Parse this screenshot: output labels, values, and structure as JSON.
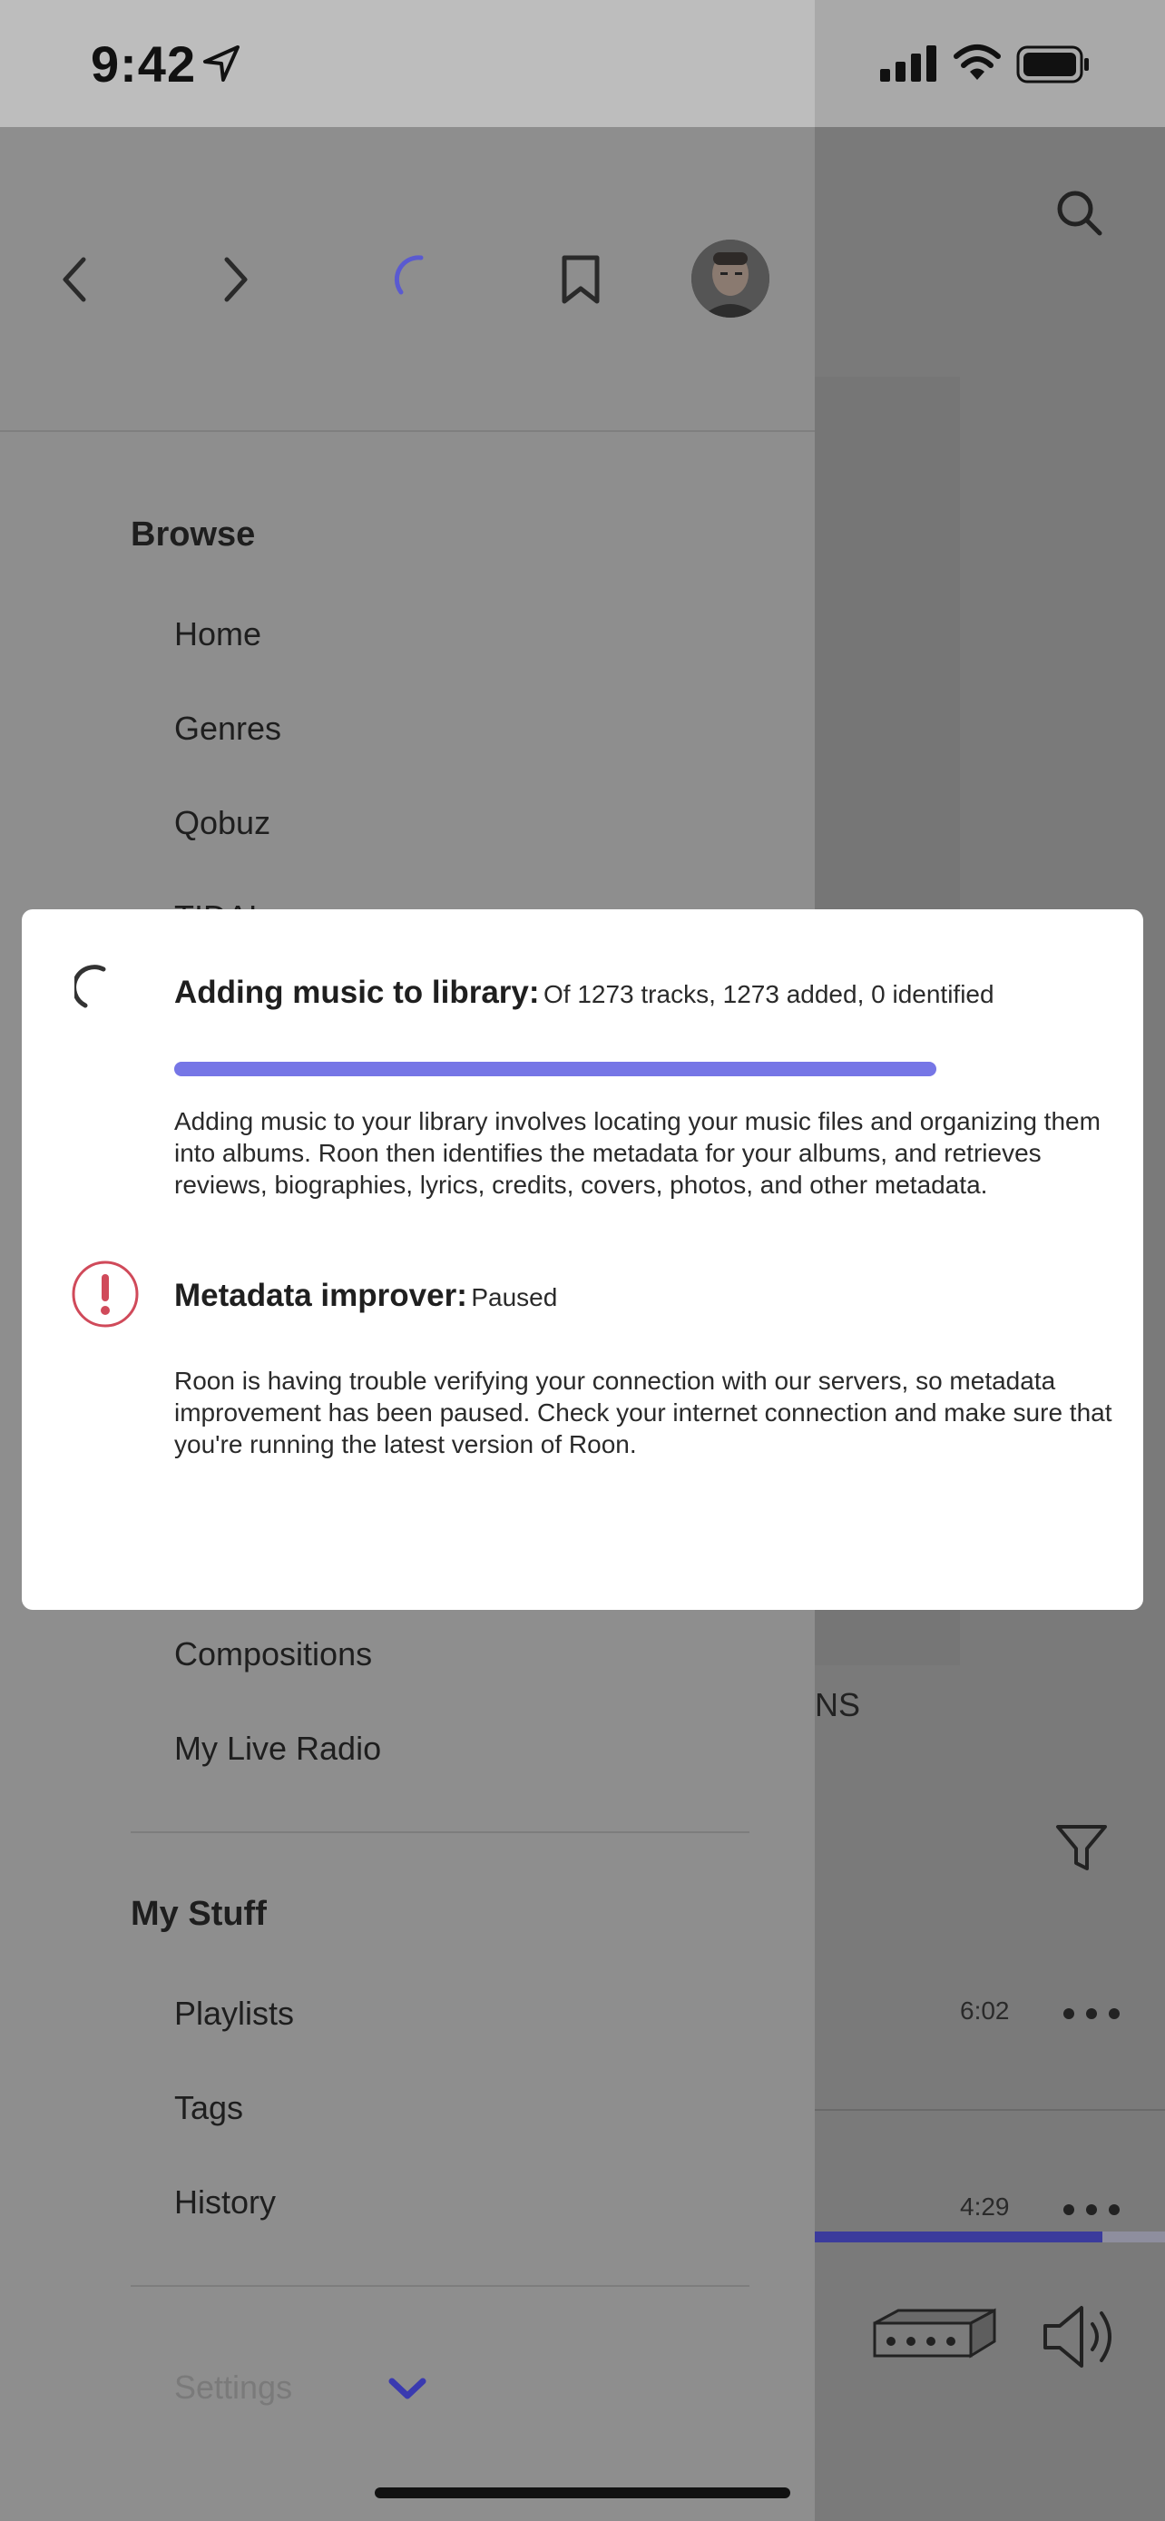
{
  "status_bar": {
    "time": "9:42",
    "location_icon": "location-arrow-icon",
    "signal_icon": "cellular-signal-icon",
    "wifi_icon": "wifi-icon",
    "battery_icon": "battery-icon"
  },
  "toolbar": {
    "back_icon": "chevron-left-icon",
    "forward_icon": "chevron-right-icon",
    "spinner_icon": "loading-spinner-icon",
    "bookmark_icon": "bookmark-icon",
    "avatar_icon": "profile-avatar-icon",
    "search_icon": "search-icon"
  },
  "drawer": {
    "browse_title": "Browse",
    "browse_items": [
      "Home",
      "Genres",
      "Qobuz",
      "TIDAL"
    ],
    "library_items": [
      "Compositions",
      "My Live Radio"
    ],
    "my_stuff_title": "My Stuff",
    "my_stuff_items": [
      "Playlists",
      "Tags",
      "History"
    ],
    "settings_label": "Settings",
    "settings_chevron_icon": "chevron-down-icon"
  },
  "right_pane": {
    "partial_label": "NS",
    "filter_icon": "filter-icon",
    "tracks": [
      {
        "duration": "6:02",
        "more_icon": "more-dots-icon"
      },
      {
        "duration": "4:29",
        "more_icon": "more-dots-icon"
      }
    ],
    "device_icon": "audio-device-icon",
    "volume_icon": "volume-icon",
    "playback_progress": 0.82
  },
  "modal": {
    "adding_title": "Adding music to library:",
    "adding_status": "Of 1273 tracks, 1273 added, 0 identified",
    "adding_progress": 1.0,
    "adding_description": "Adding music to your library involves locating your music files and organizing them into albums. Roon then identifies the metadata for your albums, and retrieves reviews, biographies, lyrics, credits, covers, photos, and other metadata.",
    "metadata_title": "Metadata improver:",
    "metadata_status": "Paused",
    "metadata_description": "Roon is having trouble verifying your connection with our servers, so metadata improvement has been paused. Check your internet connection and make sure that you're running the latest version of Roon.",
    "spinner_icon": "loading-spinner-icon",
    "warning_icon": "warning-exclamation-icon",
    "accent_color": "#7676e6",
    "warning_color": "#d04a5a"
  }
}
